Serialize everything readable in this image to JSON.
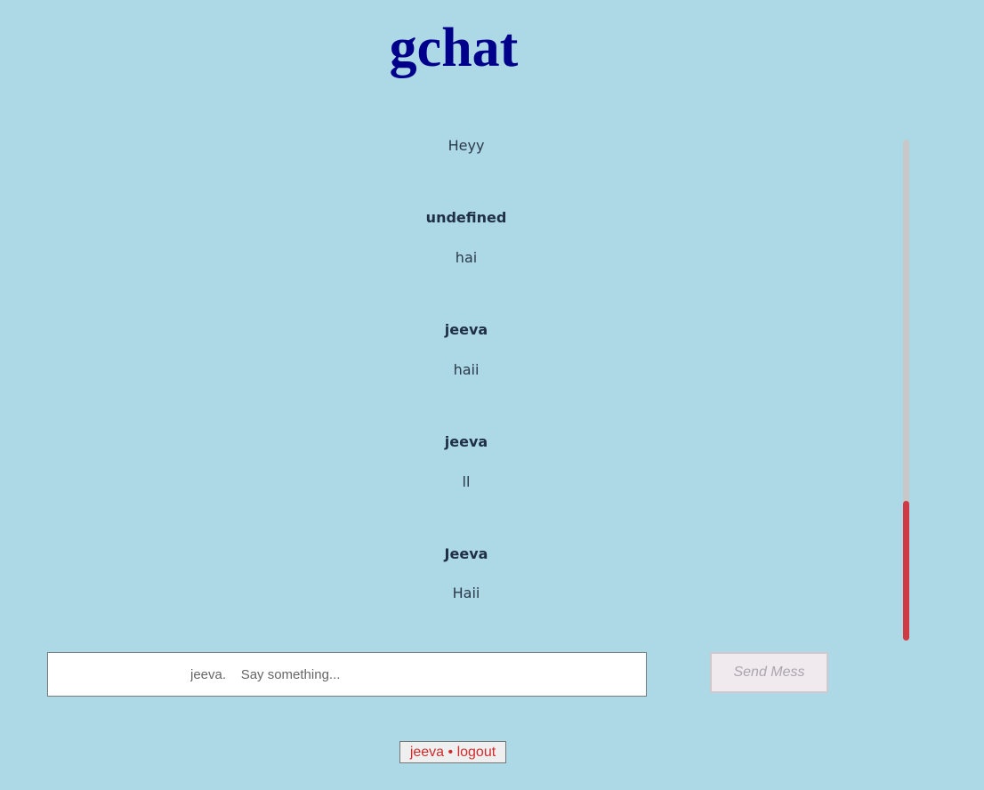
{
  "header": {
    "title": "gchat"
  },
  "messages": [
    {
      "author": "",
      "text": "Heyy"
    },
    {
      "author": "undefined",
      "text": "hai"
    },
    {
      "author": "jeeva",
      "text": "haii"
    },
    {
      "author": "jeeva",
      "text": "ll"
    },
    {
      "author": "Jeeva",
      "text": "Haii"
    }
  ],
  "composer": {
    "placeholder": "jeeva.    Say something...",
    "value": "",
    "send_label": "Send Mess"
  },
  "footer": {
    "logout_label": "jeeva • logout"
  },
  "colors": {
    "background": "#add8e6",
    "title": "#00008b",
    "scroll_thumb": "#d03a44",
    "logout_text": "#d02c2c"
  }
}
